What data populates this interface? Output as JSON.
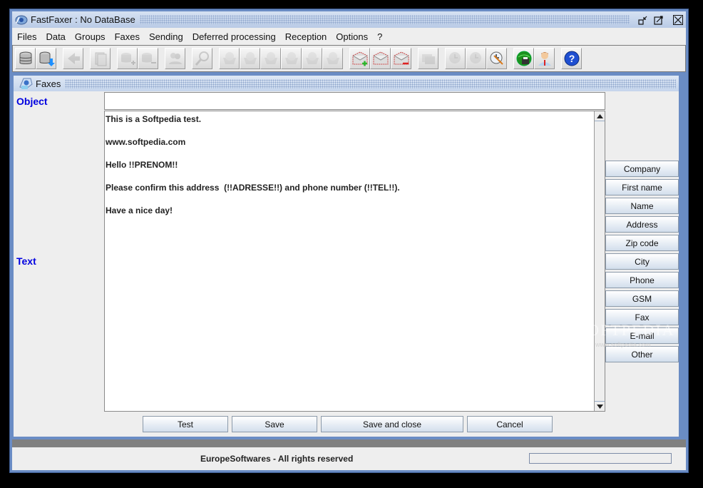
{
  "window": {
    "title": "FastFaxer : No DataBase",
    "controls": [
      "minimize-icon",
      "maximize-icon",
      "close-icon"
    ]
  },
  "menubar": {
    "items": [
      "Files",
      "Data",
      "Groups",
      "Faxes",
      "Sending",
      "Deferred processing",
      "Reception",
      "Options",
      "?"
    ]
  },
  "toolbar": {
    "buttons": [
      {
        "icon": "database-icon",
        "enabled": true
      },
      {
        "icon": "database-import-icon",
        "enabled": true
      },
      {
        "icon": "back-arrow-icon",
        "enabled": false
      },
      {
        "icon": "documents-icon",
        "enabled": false
      },
      {
        "icon": "database-add-icon",
        "enabled": false
      },
      {
        "icon": "database-remove-icon",
        "enabled": false
      },
      {
        "icon": "users-remove-icon",
        "enabled": false
      },
      {
        "icon": "search-icon",
        "enabled": false
      },
      {
        "icon": "basket-1-icon",
        "enabled": false
      },
      {
        "icon": "basket-2-icon",
        "enabled": false
      },
      {
        "icon": "basket-3-icon",
        "enabled": false
      },
      {
        "icon": "basket-4-icon",
        "enabled": false
      },
      {
        "icon": "basket-5-icon",
        "enabled": false
      },
      {
        "icon": "basket-6-icon",
        "enabled": false
      },
      {
        "icon": "mail-add-icon",
        "enabled": true
      },
      {
        "icon": "mail-edit-icon",
        "enabled": true
      },
      {
        "icon": "mail-remove-icon",
        "enabled": true
      },
      {
        "icon": "photos-icon",
        "enabled": false
      },
      {
        "icon": "clock-add-icon",
        "enabled": false
      },
      {
        "icon": "clock-remove-icon",
        "enabled": false
      },
      {
        "icon": "clock-edit-icon",
        "enabled": true
      },
      {
        "icon": "globe-fax-icon",
        "enabled": true
      },
      {
        "icon": "user-icon",
        "enabled": true
      },
      {
        "icon": "help-icon",
        "enabled": true
      }
    ]
  },
  "faxes_frame": {
    "title": "Faxes",
    "object_label": "Object",
    "object_value": "",
    "text_label": "Text",
    "text_lines": [
      "This is a Softpedia test.",
      "www.softpedia.com",
      "Hello !!PRENOM!!",
      "Please confirm this address  (!!ADRESSE!!) and phone number (!!TEL!!).",
      "Have a nice day!"
    ],
    "field_buttons": [
      "Company",
      "First name",
      "Name",
      "Address",
      "Zip code",
      "City",
      "Phone",
      "GSM",
      "Fax",
      "E-mail",
      "Other"
    ],
    "actions": {
      "test": "Test",
      "save": "Save",
      "save_close": "Save and close",
      "cancel": "Cancel"
    }
  },
  "statusbar": {
    "text": "EuropeSoftwares - All rights reserved",
    "progress": 0
  },
  "watermark": {
    "text": "SOFTPEDIA",
    "sub": "www.softpedia.com"
  }
}
